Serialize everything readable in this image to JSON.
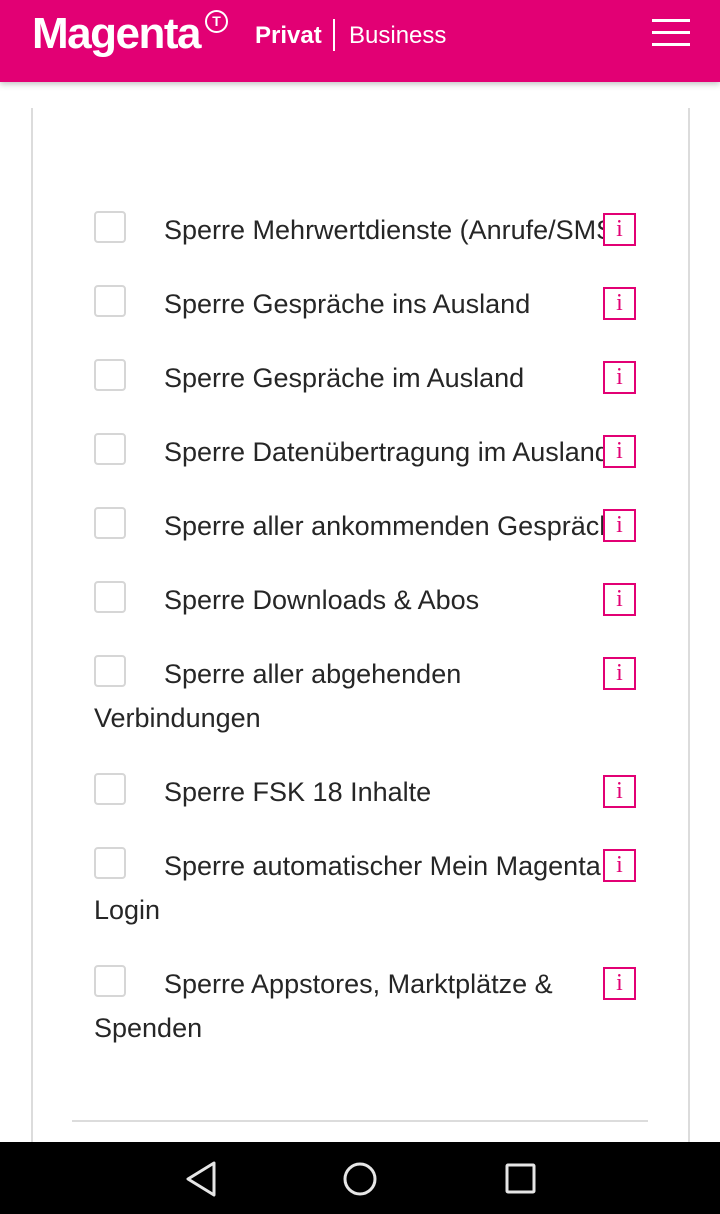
{
  "header": {
    "logo_text": "Magenta",
    "logo_mark": "T",
    "nav_privat": "Privat",
    "nav_business": "Business",
    "menu_icon": "hamburger-menu-icon"
  },
  "colors": {
    "brand": "#e20074",
    "text": "#262626",
    "checkbox_border": "#d6d6d6"
  },
  "options": [
    {
      "label": "Sperre Mehrwertdienste (Anrufe/SMS)",
      "checked": false,
      "info": "i"
    },
    {
      "label": "Sperre Gespräche ins Ausland",
      "checked": false,
      "info": "i"
    },
    {
      "label": "Sperre Gespräche im Ausland",
      "checked": false,
      "info": "i"
    },
    {
      "label": "Sperre Datenübertragung im Ausland",
      "checked": false,
      "info": "i"
    },
    {
      "label": "Sperre aller ankommenden Gespräche",
      "checked": false,
      "info": "i"
    },
    {
      "label": "Sperre Downloads & Abos",
      "checked": false,
      "info": "i"
    },
    {
      "label": "Sperre aller abgehenden Verbindungen",
      "checked": false,
      "info": "i"
    },
    {
      "label": "Sperre FSK 18 Inhalte",
      "checked": false,
      "info": "i"
    },
    {
      "label": "Sperre automatischer Mein Magenta Login",
      "checked": false,
      "info": "i"
    },
    {
      "label": "Sperre Appstores, Marktplätze & Spenden",
      "checked": false,
      "info": "i"
    }
  ],
  "system_nav": {
    "back": "back-triangle-icon",
    "home": "home-circle-icon",
    "recent": "recent-apps-square-icon"
  }
}
